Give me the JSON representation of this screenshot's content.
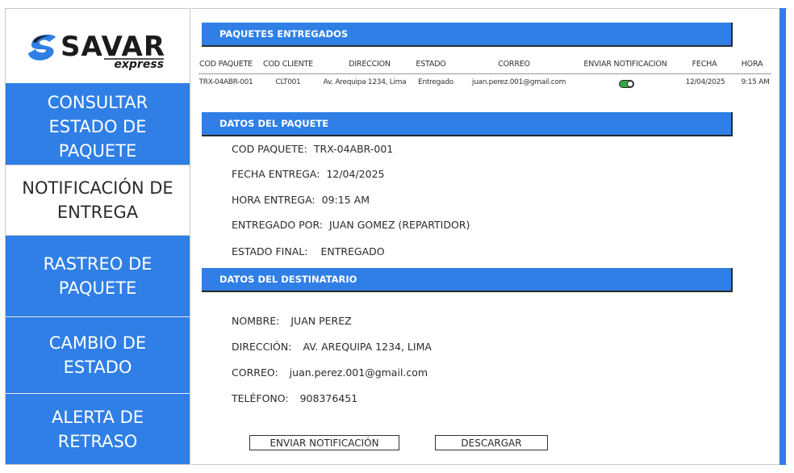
{
  "logo": {
    "brand": "SAVAR",
    "tagline": "express"
  },
  "sidebar": {
    "items": [
      {
        "label": "CONSULTAR ESTADO DE PAQUETE"
      },
      {
        "label": "NOTIFICACIÓN DE ENTREGA"
      },
      {
        "label": "RASTREO DE PAQUETE"
      },
      {
        "label": "CAMBIO DE ESTADO"
      },
      {
        "label": "ALERTA DE RETRASO"
      }
    ]
  },
  "delivered": {
    "title": "PAQUETES ENTREGADOS",
    "columns": [
      "COD PAQUETE",
      "COD CLIENTE",
      "DIRECCION",
      "ESTADO",
      "CORREO",
      "ENVIAR NOTIFICACION",
      "FECHA",
      "HORA"
    ],
    "rows": [
      {
        "cod_paquete": "TRX-04ABR-001",
        "cod_cliente": "CLT001",
        "direccion": "Av. Arequipa 1234, Lima",
        "estado": "Entregado",
        "correo": "juan.perez.001@gmail.com",
        "enviar_notificacion": true,
        "fecha": "12/04/2025",
        "hora": "9:15 AM"
      }
    ]
  },
  "package": {
    "title": "DATOS DEL PAQUETE",
    "fields": [
      {
        "label": "COD PAQUETE:",
        "value": "TRX-04ABR-001"
      },
      {
        "label": "FECHA ENTREGA:",
        "value": "12/04/2025"
      },
      {
        "label": "HORA ENTREGA:",
        "value": "09:15 AM"
      },
      {
        "label": "ENTREGADO POR:",
        "value": "JUAN GOMEZ (REPARTIDOR)"
      },
      {
        "label": "ESTADO FINAL:",
        "value": "ENTREGADO"
      }
    ]
  },
  "recipient": {
    "title": "DATOS DEL DESTINATARIO",
    "fields": [
      {
        "label": "NOMBRE:",
        "value": "JUAN PEREZ"
      },
      {
        "label": "DIRECCIÓN:",
        "value": "AV. AREQUIPA 1234, LIMA"
      },
      {
        "label": "CORREO:",
        "value": "juan.perez.001@gmail.com"
      },
      {
        "label": "TELÉFONO:",
        "value": "908376451"
      }
    ]
  },
  "actions": {
    "send_label": "ENVIAR NOTIFICACIÓN",
    "download_label": "DESCARGAR"
  },
  "colors": {
    "accent": "#2f7fe6",
    "toggle_on": "#35a645"
  }
}
